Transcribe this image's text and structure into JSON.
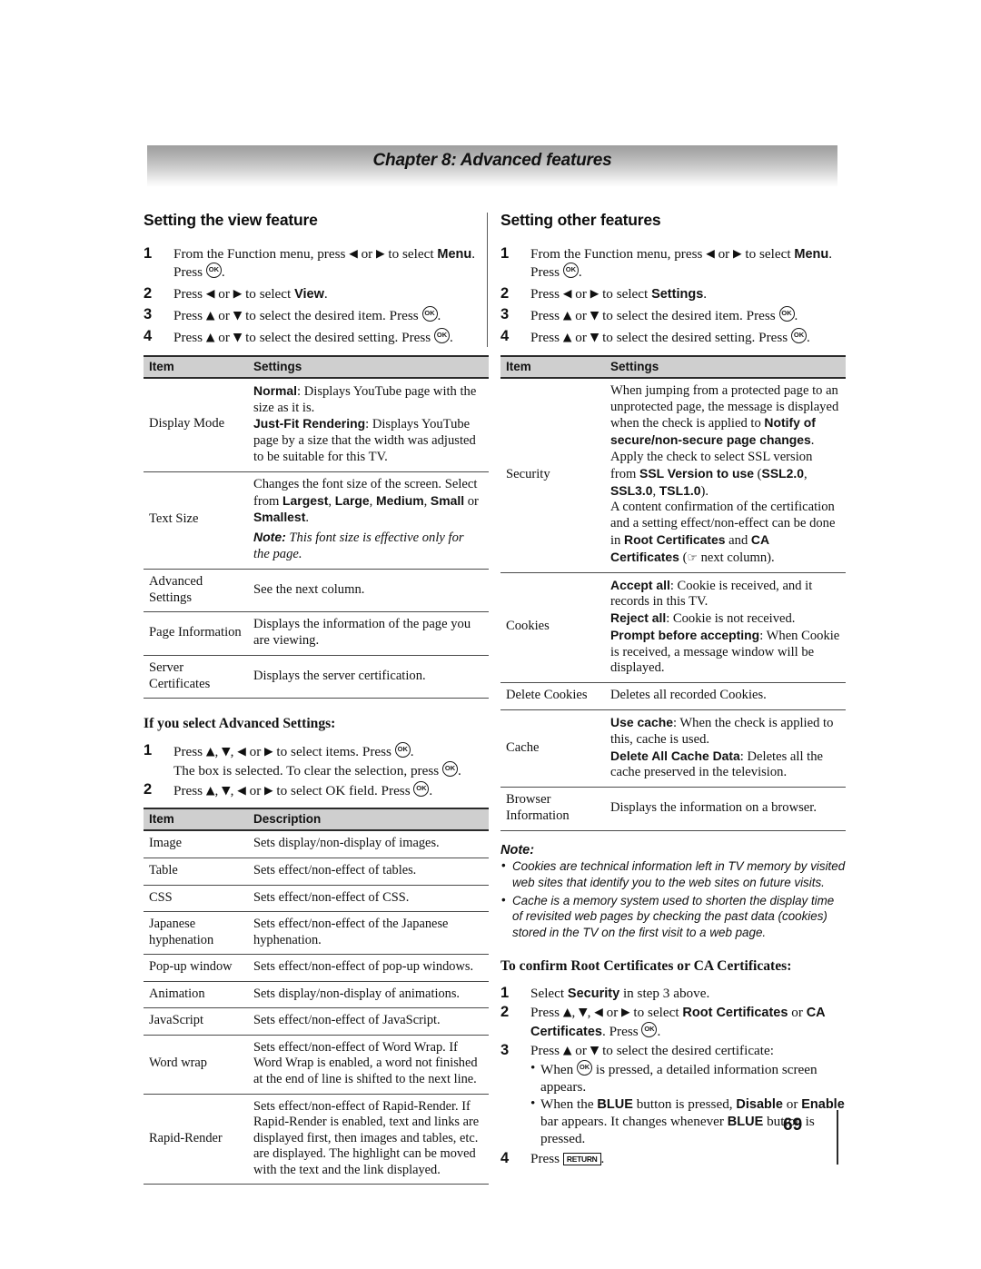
{
  "banner": {
    "title": "Chapter 8: Advanced features"
  },
  "icons": {
    "ok": "OK",
    "return": "RETURN",
    "hand": "☞",
    "left": "◀",
    "right": "▶",
    "up": "▲",
    "down": "▼"
  },
  "left_column": {
    "heading": "Setting the view feature",
    "steps": [
      {
        "num": "1",
        "html": "From the Function menu, press <span class=\"arrow\">◀</span> or <span class=\"arrow\">▶</span> to select <b>Menu</b>. Press <span class=\"okbtn\">OK</span>."
      },
      {
        "num": "2",
        "html": "Press <span class=\"arrow\">◀</span> or <span class=\"arrow\">▶</span> to select <b>View</b>."
      },
      {
        "num": "3",
        "html": "Press <span class=\"arrow\">▲</span> or <span class=\"arrow\">▼</span> to select the desired item. Press <span class=\"okbtn\">OK</span>."
      },
      {
        "num": "4",
        "html": "Press <span class=\"arrow\">▲</span> or <span class=\"arrow\">▼</span> to select the desired setting. Press <span class=\"okbtn\">OK</span>."
      }
    ],
    "table": {
      "headers": [
        "Item",
        "Settings"
      ],
      "rows": [
        {
          "item": "Display Mode",
          "settings_html": "<b>Normal</b>: Displays YouTube page with the size as it is.<br><b>Just-Fit Rendering</b>: Displays YouTube page by a size that the width was adjusted to be suitable for this TV."
        },
        {
          "item": "Text Size",
          "settings_html": "Changes the font size of the screen. Select from <b>Largest</b>, <b>Large</b>, <b>Medium</b>, <b>Small</b> or <b>Smallest</b>.<span class=\"note-inline\"><span class=\"nlabel\">Note:</span> This font size is effective only for the page.</span>"
        },
        {
          "item": "Advanced Settings",
          "settings_html": "See the next column."
        },
        {
          "item": "Page Information",
          "settings_html": "Displays the information of the page you are viewing."
        },
        {
          "item": "Server Certificates",
          "settings_html": "Displays the server certification."
        }
      ]
    },
    "subheading": "If you select Advanced Settings:",
    "adv_steps": [
      {
        "num": "1",
        "html": "Press <span class=\"arrow\">▲</span>, <span class=\"arrow\">▼</span>, <span class=\"arrow\">◀</span> or <span class=\"arrow\">▶</span> to select items. Press <span class=\"okbtn\">OK</span>.<br>The box is selected. To clear the selection, press <span class=\"okbtn\">OK</span>."
      },
      {
        "num": "2",
        "html": "Press <span class=\"arrow\">▲</span>, <span class=\"arrow\">▼</span>, <span class=\"arrow\">◀</span> or <span class=\"arrow\">▶</span> to select OK field. Press <span class=\"okbtn\">OK</span>."
      }
    ],
    "adv_table": {
      "headers": [
        "Item",
        "Description"
      ],
      "rows": [
        {
          "item": "Image",
          "settings_html": "Sets display/non-display of images."
        },
        {
          "item": "Table",
          "settings_html": "Sets effect/non-effect of tables."
        },
        {
          "item": "CSS",
          "settings_html": "Sets effect/non-effect of CSS."
        },
        {
          "item": "Japanese hyphenation",
          "settings_html": "Sets effect/non-effect of the Japanese hyphenation."
        },
        {
          "item": "Pop-up window",
          "settings_html": "Sets effect/non-effect of pop-up windows."
        },
        {
          "item": "Animation",
          "settings_html": "Sets display/non-display of animations."
        },
        {
          "item": "JavaScript",
          "settings_html": "Sets effect/non-effect of JavaScript."
        },
        {
          "item": "Word wrap",
          "settings_html": "Sets effect/non-effect of Word Wrap. If Word Wrap is enabled, a word not finished at the end of line is shifted to the next line."
        },
        {
          "item": "Rapid-Render",
          "settings_html": "Sets effect/non-effect of Rapid-Render. If Rapid-Render is enabled, text and links are displayed first, then images and tables, etc. are displayed. The highlight can be moved with the text and the link displayed."
        }
      ]
    }
  },
  "right_column": {
    "heading": "Setting other features",
    "steps": [
      {
        "num": "1",
        "html": "From the Function menu, press <span class=\"arrow\">◀</span> or <span class=\"arrow\">▶</span> to select <b>Menu</b>. Press <span class=\"okbtn\">OK</span>."
      },
      {
        "num": "2",
        "html": "Press <span class=\"arrow\">◀</span> or <span class=\"arrow\">▶</span> to select <b>Settings</b>."
      },
      {
        "num": "3",
        "html": "Press <span class=\"arrow\">▲</span> or <span class=\"arrow\">▼</span> to select the desired item. Press <span class=\"okbtn\">OK</span>."
      },
      {
        "num": "4",
        "html": "Press <span class=\"arrow\">▲</span> or <span class=\"arrow\">▼</span> to select the desired setting. Press <span class=\"okbtn\">OK</span>."
      }
    ],
    "table": {
      "headers": [
        "Item",
        "Settings"
      ],
      "rows": [
        {
          "item": "Security",
          "settings_html": "When jumping from a protected page to an unprotected page, the message is displayed when the check is applied to <b>Notify of secure/non-secure page changes</b>.<br>Apply the check to select SSL version from <b>SSL Version to use</b> (<b>SSL2.0</b>, <b>SSL3.0</b>, <b>TSL1.0</b>).<br>A content confirmation of the certification and a setting effect/non-effect can be done in <b>Root Certificates</b> and <b>CA Certificates</b> (<span class=\"hand\">☞</span> next column)."
        },
        {
          "item": "Cookies",
          "settings_html": "<b>Accept all</b>: Cookie is received, and it records in this TV.<br><b>Reject all</b>: Cookie is not received.<br><b>Prompt before accepting</b>: When Cookie is received, a message window will be displayed."
        },
        {
          "item": "Delete Cookies",
          "settings_html": "Deletes all recorded Cookies."
        },
        {
          "item": "Cache",
          "settings_html": "<b>Use cache</b>: When the check is applied to this, cache is used.<br><b>Delete All Cache Data</b>: Deletes all the cache preserved in the television."
        },
        {
          "item": "Browser Information",
          "settings_html": "Displays the information on a browser."
        }
      ]
    },
    "note": {
      "title": "Note:",
      "items": [
        "Cookies are technical information left in TV memory by visited web sites that identify you to the web sites on future visits.",
        "Cache is a memory system used to shorten the display time of revisited web pages by checking the past data (cookies) stored in the TV on the first visit to a web page."
      ]
    },
    "subheading": "To confirm Root Certificates or CA Certificates:",
    "cert_steps": [
      {
        "num": "1",
        "html": "Select <b>Security</b> in step 3 above."
      },
      {
        "num": "2",
        "html": "Press <span class=\"arrow\">▲</span>, <span class=\"arrow\">▼</span>, <span class=\"arrow\">◀</span> or <span class=\"arrow\">▶</span> to select <b>Root Certificates</b> or <b>CA Certificates</b>. Press <span class=\"okbtn\">OK</span>."
      },
      {
        "num": "3",
        "html": "Press <span class=\"arrow\">▲</span> or <span class=\"arrow\">▼</span> to select the desired certificate:<ul class=\"substeps\"><li>When <span class=\"okbtn\">OK</span> is pressed, a detailed information screen appears.</li><li>When the <b>BLUE</b> button is pressed, <b>Disable</b> or <b>Enable</b> bar appears. It changes whenever <b>BLUE</b> button is pressed.</li></ul>"
      },
      {
        "num": "4",
        "html": "Press <span class=\"returnbtn\">RETURN</span>."
      }
    ]
  },
  "footer": {
    "page_number": "69"
  }
}
